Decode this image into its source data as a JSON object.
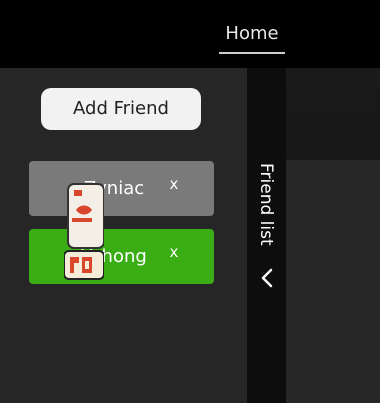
{
  "nav": {
    "home_label": "Home"
  },
  "sidebar": {
    "add_friend_label": "Add Friend",
    "friends": [
      {
        "name": "Zyniac",
        "remove_label": "x",
        "color": "#7a7a7a"
      },
      {
        "name": "Yuhong",
        "remove_label": "x",
        "color": "#3aad15"
      }
    ]
  },
  "friend_tab": {
    "label": "Friend list",
    "toggle_icon": "chevron-left-icon"
  },
  "colors": {
    "background": "#000000",
    "sidebar": "#262626",
    "active_friend": "#3aad15",
    "inactive_friend": "#7a7a7a",
    "logo_red": "#d8462c"
  }
}
